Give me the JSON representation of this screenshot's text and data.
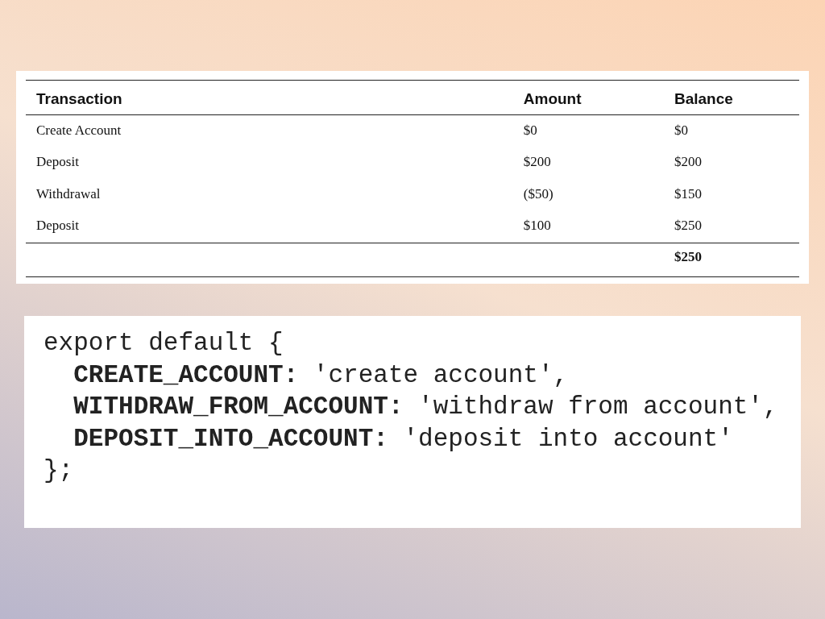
{
  "table": {
    "columns": [
      "Transaction",
      "Amount",
      "Balance"
    ],
    "rows": [
      {
        "transaction": "Create Account",
        "amount": "$0",
        "balance": "$0"
      },
      {
        "transaction": "Deposit",
        "amount": "$200",
        "balance": "$200"
      },
      {
        "transaction": "Withdrawal",
        "amount": "($50)",
        "balance": "$150"
      },
      {
        "transaction": "Deposit",
        "amount": "$100",
        "balance": "$250"
      }
    ],
    "total": "$250"
  },
  "code": {
    "lines": [
      "export default {",
      "  **CREATE_ACCOUNT:** 'create account',",
      "  **WITHDRAW_FROM_ACCOUNT:** 'withdraw from account',",
      "  **DEPOSIT_INTO_ACCOUNT:** 'deposit into account'",
      "};"
    ]
  }
}
